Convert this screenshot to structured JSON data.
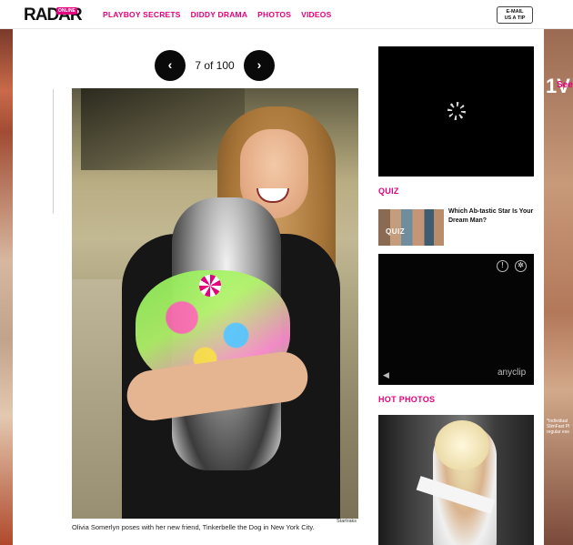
{
  "header": {
    "logo": "RADAR",
    "logo_tag": "ONLINE",
    "nav": [
      "PLAYBOY SECRETS",
      "DIDDY DRAMA",
      "PHOTOS",
      "VIDEOS"
    ],
    "tip_button": [
      "E-MAIL",
      "US A TIP"
    ]
  },
  "pager": {
    "prev_icon": "‹",
    "count": "7 of 100",
    "next_icon": "›"
  },
  "main_photo": {
    "credit": "Startraks",
    "caption": "Olivia Somerlyn poses with her new friend, Tinkerbelle the Dog in New York City."
  },
  "sidebar": {
    "quiz": {
      "section_title": "QUIZ",
      "thumb_label": "QUIZ",
      "text": "Which Ab-tastic Star Is Your Dream Man?"
    },
    "video": {
      "info_icon": "!",
      "gear_icon": "✲",
      "mute_icon": "◀",
      "brand": "anyclip"
    },
    "hot_photos": {
      "section_title": "HOT PHOTOS"
    }
  },
  "rails": {
    "right_big": "1V",
    "right_see": "See",
    "right_fine": "*Individual SlimFast Pl regular exe"
  },
  "colors": {
    "accent": "#e5007d",
    "black": "#0a0a0a"
  }
}
